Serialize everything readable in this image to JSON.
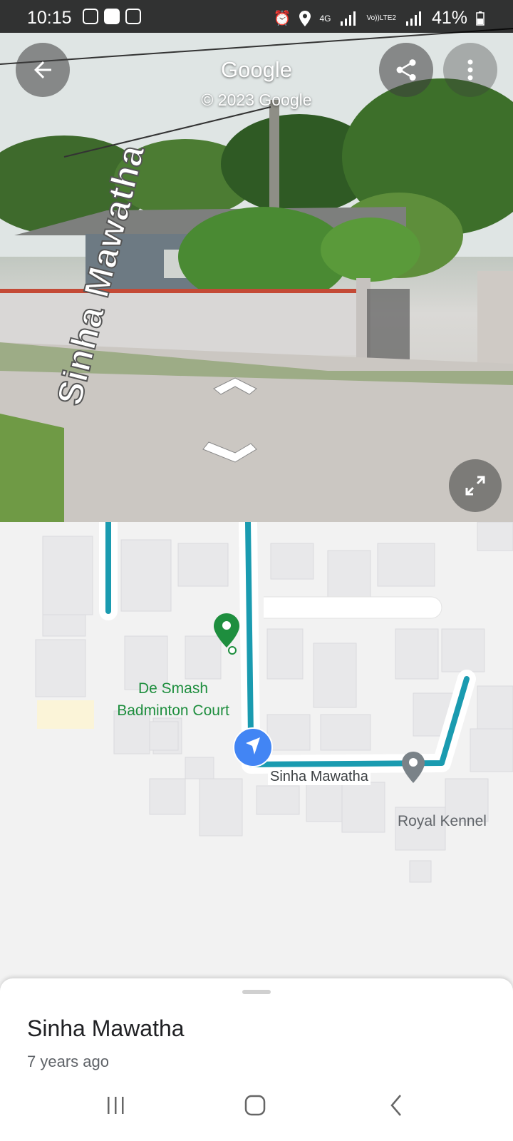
{
  "status_bar": {
    "time": "10:15",
    "network": "4G",
    "volte": "Vo))LTE2",
    "battery": "41%"
  },
  "header": {
    "title": "Google",
    "subtitle": "© 2023 Google"
  },
  "street_view": {
    "road_label": "Sinha Mawatha"
  },
  "map": {
    "places": {
      "de_smash": "De Smash\nBadminton Court",
      "royal_kennel": "Royal Kennel"
    },
    "road_label": "Sinha Mawatha",
    "colors": {
      "route": "#1a9bb0",
      "place_green": "#1e8e3e",
      "you_marker": "#4285f4"
    }
  },
  "sheet": {
    "title": "Sinha Mawatha",
    "subtitle": "7 years ago"
  }
}
